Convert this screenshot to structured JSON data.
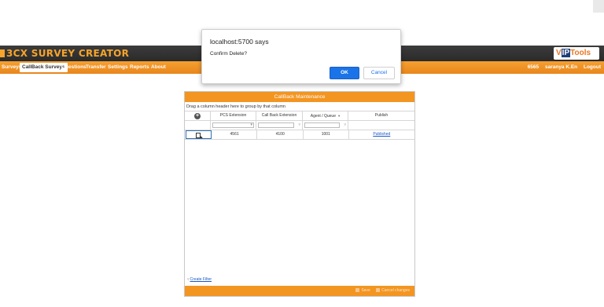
{
  "header": {
    "app_title": "3CX SURVEY CREATOR",
    "logo_v": "V",
    "logo_ip": "IP",
    "logo_tools": "Tools"
  },
  "nav": {
    "items": [
      "Surveys",
      "CallBack Surveys",
      "Questions",
      "Transfer",
      "Settings",
      "Reports",
      "About"
    ],
    "active": "CallBack Surveys",
    "user_ext": "6565",
    "user_name": "saranya K.En",
    "logout": "Logout"
  },
  "panel": {
    "title": "CallBack Maintenance",
    "group_hint": "Drag a column header here to group by that column",
    "columns": [
      "PCS Extension",
      "Call Back Extension",
      "Agent / Queue",
      "Publish"
    ],
    "rows": [
      {
        "pcs_extension": "4561",
        "call_back_extension": "4100",
        "agent_queue": "1001",
        "publish": "Published"
      }
    ],
    "create_filter": "Create Filter",
    "save_label": "Save",
    "cancel_changes_label": "Cancel changes"
  },
  "dialog": {
    "title": "localhost:5700 says",
    "message": "Confirm Delete?",
    "ok_label": "OK",
    "cancel_label": "Cancel"
  },
  "colors": {
    "accent": "#f39521",
    "header_bg": "#333333",
    "title_color": "#f6a42b",
    "button_blue": "#1a73e8"
  }
}
